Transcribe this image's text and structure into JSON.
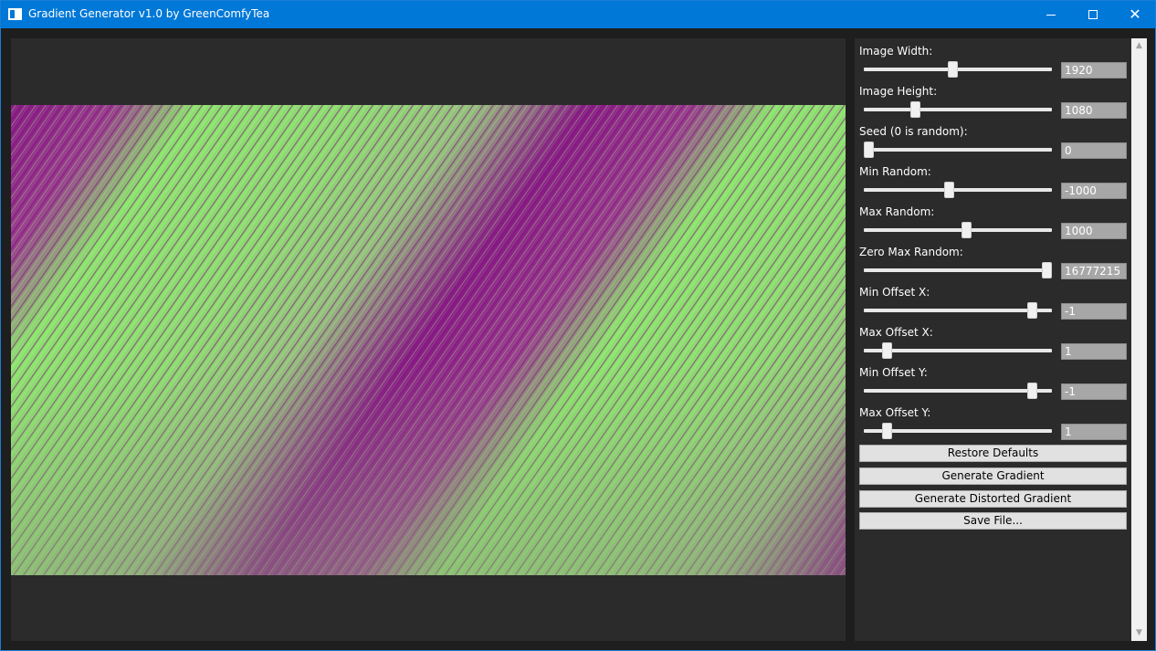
{
  "window": {
    "title": "Gradient Generator v1.0 by GreenComfyTea",
    "icon": "app-window-icon"
  },
  "caption_buttons": {
    "minimize_icon": "minimize-icon",
    "maximize_icon": "maximize-icon",
    "close_icon": "close-icon",
    "close_glyph": "✕"
  },
  "gradient": {
    "color_a": "#8a1a86",
    "color_b": "#8de46e",
    "color_c": "#8a9a7a"
  },
  "settings": [
    {
      "label": "Image Width:",
      "value": "1920",
      "level": 0.47
    },
    {
      "label": "Image Height:",
      "value": "1080",
      "level": 0.26
    },
    {
      "label": "Seed (0 is random):",
      "value": "0",
      "level": 0.0
    },
    {
      "label": "Min Random:",
      "value": "-1000",
      "level": 0.45
    },
    {
      "label": "Max Random:",
      "value": "1000",
      "level": 0.55
    },
    {
      "label": "Zero Max Random:",
      "value": "16777215",
      "level": 1.0
    },
    {
      "label": "Min Offset X:",
      "value": "-1",
      "level": 0.92
    },
    {
      "label": "Max Offset X:",
      "value": "1",
      "level": 0.1
    },
    {
      "label": "Min Offset Y:",
      "value": "-1",
      "level": 0.92
    },
    {
      "label": "Max Offset Y:",
      "value": "1",
      "level": 0.1
    }
  ],
  "buttons": {
    "restore_defaults": "Restore Defaults",
    "generate_gradient": "Generate Gradient",
    "generate_distorted": "Generate Distorted Gradient",
    "save_file": "Save File..."
  },
  "scrollbar": {
    "up_glyph": "▲",
    "down_glyph": "▼"
  }
}
